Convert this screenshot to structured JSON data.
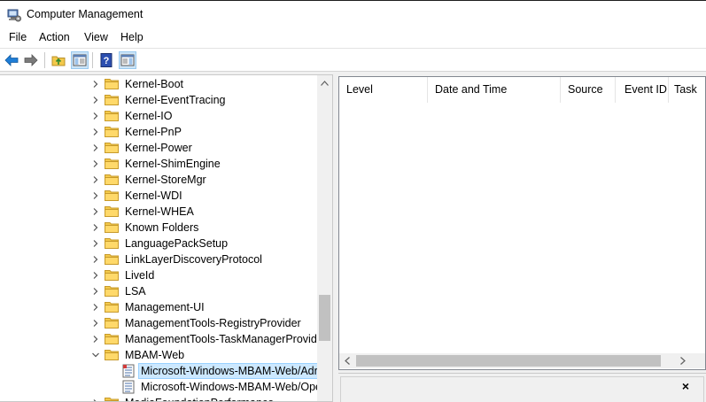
{
  "window": {
    "title": "Computer Management"
  },
  "menu": [
    "File",
    "Action",
    "View",
    "Help"
  ],
  "toolbar": {
    "buttons": [
      "back-icon",
      "forward-icon",
      "up-folder-icon",
      "show-hide-tree-icon",
      "help-icon",
      "show-hide-action-pane-icon"
    ]
  },
  "tree": {
    "items": [
      {
        "label": "Kernel-Boot",
        "type": "folder",
        "expanded": false
      },
      {
        "label": "Kernel-EventTracing",
        "type": "folder",
        "expanded": false
      },
      {
        "label": "Kernel-IO",
        "type": "folder",
        "expanded": false
      },
      {
        "label": "Kernel-PnP",
        "type": "folder",
        "expanded": false
      },
      {
        "label": "Kernel-Power",
        "type": "folder",
        "expanded": false
      },
      {
        "label": "Kernel-ShimEngine",
        "type": "folder",
        "expanded": false
      },
      {
        "label": "Kernel-StoreMgr",
        "type": "folder",
        "expanded": false
      },
      {
        "label": "Kernel-WDI",
        "type": "folder",
        "expanded": false
      },
      {
        "label": "Kernel-WHEA",
        "type": "folder",
        "expanded": false
      },
      {
        "label": "Known Folders",
        "type": "folder",
        "expanded": false
      },
      {
        "label": "LanguagePackSetup",
        "type": "folder",
        "expanded": false
      },
      {
        "label": "LinkLayerDiscoveryProtocol",
        "type": "folder",
        "expanded": false
      },
      {
        "label": "LiveId",
        "type": "folder",
        "expanded": false
      },
      {
        "label": "LSA",
        "type": "folder",
        "expanded": false
      },
      {
        "label": "Management-UI",
        "type": "folder",
        "expanded": false
      },
      {
        "label": "ManagementTools-RegistryProvider",
        "type": "folder",
        "expanded": false
      },
      {
        "label": "ManagementTools-TaskManagerProvider",
        "type": "folder",
        "expanded": false
      },
      {
        "label": "MBAM-Web",
        "type": "folder",
        "expanded": true
      },
      {
        "label": "Microsoft-Windows-MBAM-Web/Adr",
        "type": "log",
        "selected": true
      },
      {
        "label": "Microsoft-Windows-MBAM-Web/Ope",
        "type": "log",
        "selected": false
      },
      {
        "label": "MediaFoundationPerformance",
        "type": "folder",
        "expanded": false
      }
    ]
  },
  "list": {
    "columns": [
      "Level",
      "Date and Time",
      "Source",
      "Event ID",
      "Task"
    ],
    "rows": []
  },
  "preview": {
    "close_label": "×"
  },
  "colors": {
    "selection": "#cce8ff",
    "folder": "#f3c94b",
    "accent": "#1e7dd6"
  }
}
